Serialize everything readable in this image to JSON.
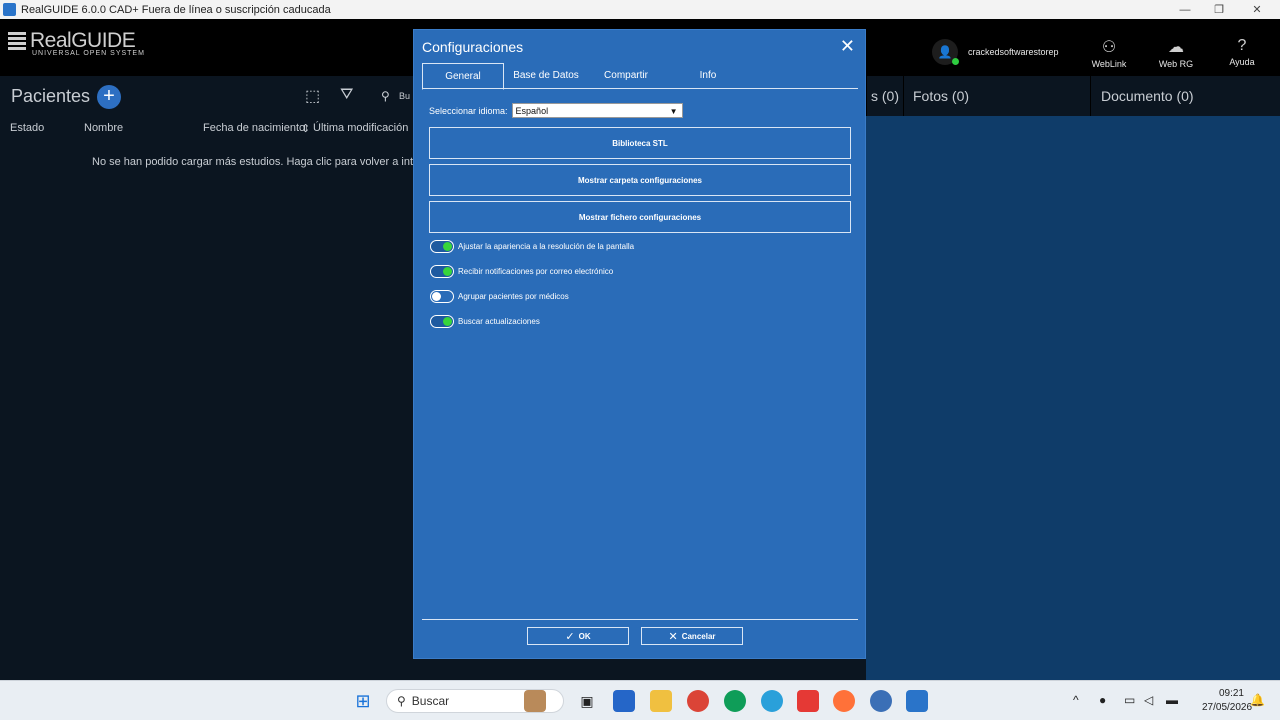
{
  "window": {
    "title": "RealGUIDE  6.0.0  CAD+ Fuera de línea o suscripción caducada",
    "minimize_icon": "—",
    "maximize_icon": "❐",
    "close_icon": "✕"
  },
  "header": {
    "logo_name": "RealGUIDE",
    "logo_sub": "UNIVERSAL OPEN SYSTEM",
    "username": "crackedsoftwarestorep",
    "buttons": [
      {
        "label": "WebLink",
        "icon": "weblink-icon"
      },
      {
        "label": "Web RG",
        "icon": "cloud-icon"
      },
      {
        "label": "Ayuda",
        "icon": "help-icon"
      }
    ]
  },
  "patients": {
    "title": "Pacientes",
    "add": "+",
    "search_placeholder": "Bu",
    "columns": [
      "Estado",
      "Nombre",
      "Fecha de nacimiento",
      "Última modificación"
    ],
    "empty_message": "No se han podido cargar más estudios. Haga clic para volver a inten"
  },
  "right_tabs": {
    "partial": "s (0)",
    "fotos": "Fotos (0)",
    "documento": "Documento (0)"
  },
  "dialog": {
    "title": "Configuraciones",
    "tabs": [
      "General",
      "Base de Datos",
      "Compartir",
      "Info"
    ],
    "active_tab": "General",
    "language_label": "Seleccionar idioma:",
    "language_value": "Español",
    "buttons": [
      "Biblioteca STL",
      "Mostrar carpeta configuraciones",
      "Mostrar fichero configuraciones"
    ],
    "options": [
      {
        "label": "Ajustar la apariencia a la resolución de la pantalla",
        "on": true
      },
      {
        "label": "Recibir notificaciones por correo electrónico",
        "on": true
      },
      {
        "label": "Agrupar pacientes por médicos",
        "on": false
      },
      {
        "label": "Buscar actualizaciones",
        "on": true
      }
    ],
    "ok": "OK",
    "cancel": "Cancelar"
  },
  "taskbar": {
    "search_label": "Buscar",
    "time": "09:21",
    "date": "27/05/2026"
  }
}
